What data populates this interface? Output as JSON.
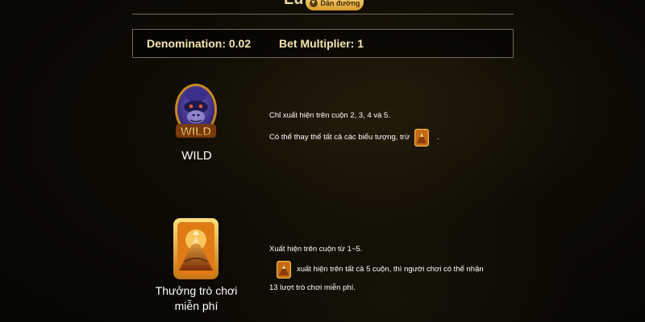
{
  "header": {
    "title_partial": "Lu",
    "guide_button": "Dẫn đường",
    "guide_icon": "chevron-down-icon"
  },
  "bet_info": {
    "denomination": "Denomination: 0.02",
    "multiplier": "Bet Multiplier: 1"
  },
  "symbols": [
    {
      "name": "WILD",
      "icon": "gorilla-wild-icon",
      "desc_line1": "Chỉ xuất hiện trên cuộn 2, 3, 4 và 5.",
      "desc_line2_before": "Có thể thay thế tất cả các biểu tượng, trừ",
      "desc_line2_after": "."
    },
    {
      "name": "Thưởng trò chơi miễn phí",
      "icon": "mountain-scatter-icon",
      "desc_line1": "Xuất hiện trên cuộn từ 1~5.",
      "desc_line2": "xuất hiện trên tất cả 5 cuộn, thì người chơi có thể nhận",
      "desc_line3": "13 lượt trò chơi miễn phí."
    }
  ],
  "colors": {
    "accent_gold": "#f4e6b0",
    "button_gold": "#e8b54a",
    "background": "#0e0b04"
  }
}
